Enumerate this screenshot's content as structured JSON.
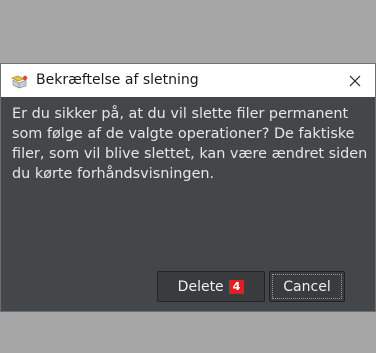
{
  "dialog": {
    "title": "Bekræftelse af sletning",
    "icon": "delete-confirm-icon",
    "message_lines": [
      "Er du sikker på, at du vil slette filer permanent",
      "som følge af de valgte operationer? De faktiske",
      "filer, som vil blive slettet, kan være ændret siden",
      "du kørte forhåndsvisningen."
    ],
    "buttons": {
      "delete_label": "Delete",
      "delete_count": "4",
      "cancel_label": "Cancel"
    }
  },
  "colors": {
    "dialog_bg": "#444749",
    "titlebar_bg": "#ffffff",
    "badge": "#e02020",
    "backdrop": "#a6a6a6"
  }
}
